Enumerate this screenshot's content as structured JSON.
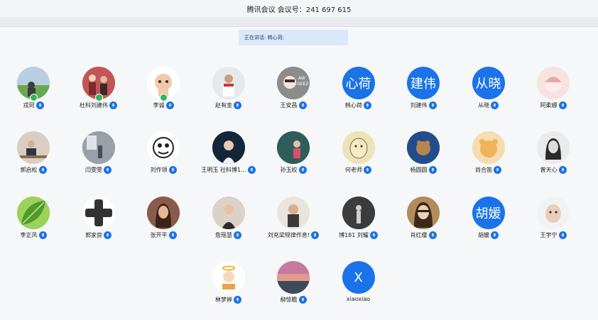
{
  "window": {
    "title": "腾讯会议 会议号：241 697 615"
  },
  "speaking": {
    "label": "正在讲话: 韩心荷;"
  },
  "participants": [
    {
      "name": "戎珂",
      "avatar_text": "",
      "avatar": "photo-field",
      "badge": true
    },
    {
      "name": "杜科刘建伟",
      "avatar_text": "",
      "avatar": "photo-crowd",
      "badge": true
    },
    {
      "name": "李诚",
      "avatar_text": "",
      "avatar": "cartoon-cat",
      "badge": true
    },
    {
      "name": "赵有金",
      "avatar_text": "",
      "avatar": "photo-person"
    },
    {
      "name": "王安昌",
      "avatar_text": "",
      "avatar": "cartoon-glasses"
    },
    {
      "name": "韩心荷",
      "avatar_text": "心荷",
      "avatar": "text"
    },
    {
      "name": "刘建伟",
      "avatar_text": "建伟",
      "avatar": "text"
    },
    {
      "name": "从晓",
      "avatar_text": "从晓",
      "avatar": "text"
    },
    {
      "name": "阿柔娜",
      "avatar_text": "",
      "avatar": "cartoon-girl"
    },
    {
      "name": "郭启松",
      "avatar_text": "",
      "avatar": "photo-desk"
    },
    {
      "name": "闫雯雯",
      "avatar_text": "",
      "avatar": "photo-room"
    },
    {
      "name": "刘作领",
      "avatar_text": "",
      "avatar": "sketch-face"
    },
    {
      "name": "王明玉 社科博1...",
      "avatar_text": "",
      "avatar": "photo-dark-girl"
    },
    {
      "name": "孙玉姣",
      "avatar_text": "",
      "avatar": "photo-teal"
    },
    {
      "name": "何老师",
      "avatar_text": "",
      "avatar": "drawing-face"
    },
    {
      "name": "杨圆圆",
      "avatar_text": "",
      "avatar": "photo-cat-blue"
    },
    {
      "name": "尚合笛",
      "avatar_text": "",
      "avatar": "cartoon-bear"
    },
    {
      "name": "曾天心",
      "avatar_text": "",
      "avatar": "photo-bw-girl"
    },
    {
      "name": "李正风",
      "avatar_text": "",
      "avatar": "leaf"
    },
    {
      "name": "郭家良",
      "avatar_text": "",
      "avatar": "cross"
    },
    {
      "name": "张开平",
      "avatar_text": "",
      "avatar": "photo-woman"
    },
    {
      "name": "詹瑶慧",
      "avatar_text": "",
      "avatar": "photo-woman-2"
    },
    {
      "name": "刘充梁规律作息!",
      "avatar_text": "",
      "avatar": "photo-man-light"
    },
    {
      "name": "博181 刘耀",
      "avatar_text": "",
      "avatar": "photo-bw-figure"
    },
    {
      "name": "肖红缨",
      "avatar_text": "",
      "avatar": "photo-glasses-woman"
    },
    {
      "name": "胡媛",
      "avatar_text": "胡媛",
      "avatar": "text"
    },
    {
      "name": "王宇宁",
      "avatar_text": "",
      "avatar": "photo-child"
    },
    {
      "name": "林梦婷",
      "avatar_text": "",
      "avatar": "cartoon-angel"
    },
    {
      "name": "柳惊瞻",
      "avatar_text": "",
      "avatar": "photo-sunset"
    },
    {
      "name": "xiaoxiao",
      "avatar_text": "X",
      "avatar": "text",
      "no_mic": true
    }
  ]
}
